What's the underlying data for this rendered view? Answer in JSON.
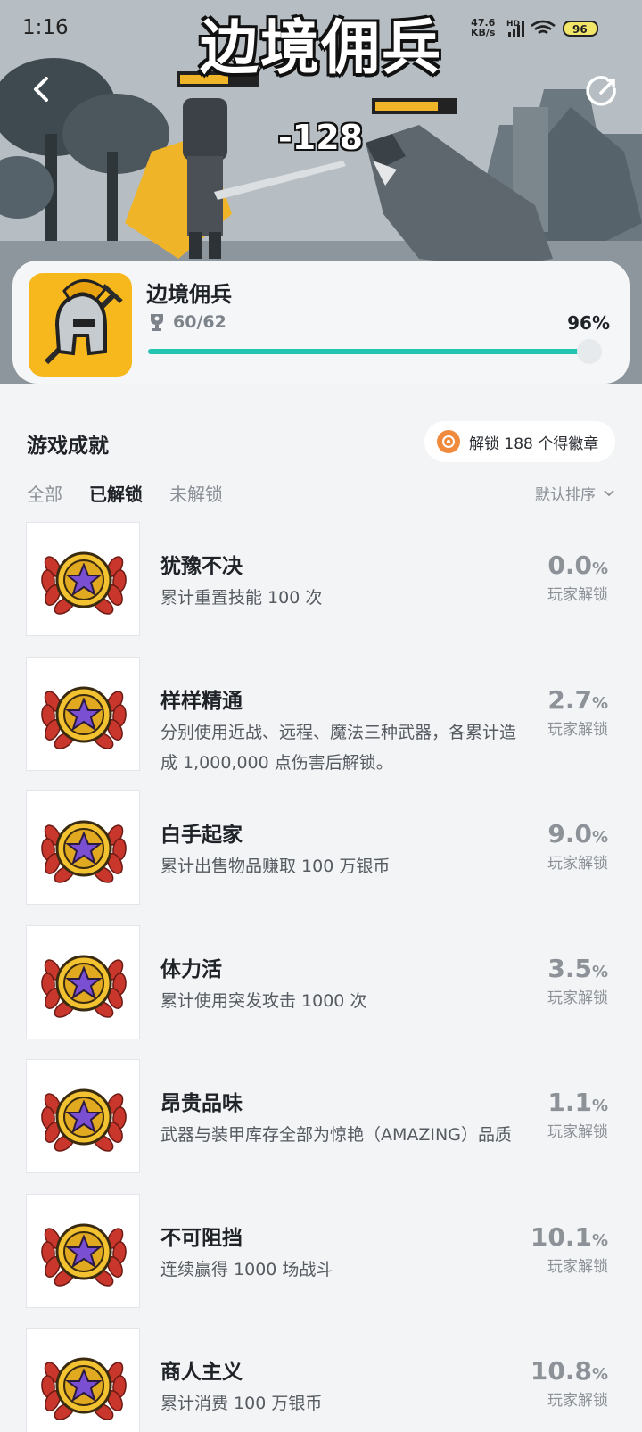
{
  "status": {
    "time": "1:16",
    "net_speed": "47.6",
    "net_unit": "KB/s",
    "hd": "HD",
    "battery": "96"
  },
  "hero": {
    "title_art": "边境佣兵",
    "damage_text": "-128"
  },
  "game": {
    "name": "边境佣兵",
    "trophies": "60/62",
    "percent": "96%",
    "progress": 0.96
  },
  "section": {
    "title": "游戏成就",
    "badge_text": "解锁 188 个得徽章"
  },
  "tabs": [
    {
      "label": "全部"
    },
    {
      "label": "已解锁"
    },
    {
      "label": "未解锁"
    }
  ],
  "sort": {
    "label": "默认排序"
  },
  "achievements": [
    {
      "name": "犹豫不决",
      "desc": "累计重置技能 100 次",
      "rate": "0.0",
      "unit": "%",
      "rate_label": "玩家解锁"
    },
    {
      "name": "样样精通",
      "desc": "分别使用近战、远程、魔法三种武器，各累计造成 1,000,000 点伤害后解锁。",
      "rate": "2.7",
      "unit": "%",
      "rate_label": "玩家解锁"
    },
    {
      "name": "白手起家",
      "desc": "累计出售物品赚取 100 万银币",
      "rate": "9.0",
      "unit": "%",
      "rate_label": "玩家解锁"
    },
    {
      "name": "体力活",
      "desc": "累计使用突发攻击 1000 次",
      "rate": "3.5",
      "unit": "%",
      "rate_label": "玩家解锁"
    },
    {
      "name": "昂贵品味",
      "desc": "武器与装甲库存全部为惊艳（AMAZING）品质",
      "rate": "1.1",
      "unit": "%",
      "rate_label": "玩家解锁"
    },
    {
      "name": "不可阻挡",
      "desc": "连续赢得 1000 场战斗",
      "rate": "10.1",
      "unit": "%",
      "rate_label": "玩家解锁"
    },
    {
      "name": "商人主义",
      "desc": "累计消费 100 万银币",
      "rate": "10.8",
      "unit": "%",
      "rate_label": "玩家解锁"
    }
  ],
  "colors": {
    "accent": "#21c4b1",
    "badge": "#f08a3c",
    "medal_gold": "#f2c230",
    "medal_star": "#7b4fd1",
    "laurel": "#c9362c"
  }
}
